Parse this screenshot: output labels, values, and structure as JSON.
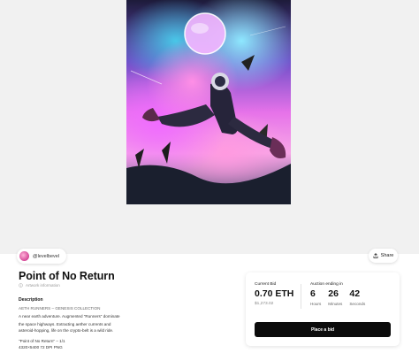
{
  "creator": {
    "handle": "@levelbevel"
  },
  "share": {
    "label": "Share"
  },
  "nft": {
    "title": "Point of No Return",
    "info_link": "Artwork information"
  },
  "description": {
    "label": "Description",
    "collection": "AETH RUNNERS – GENESIS COLLECTION",
    "line1": "A near earth adventure. Augmented \"Runners\" dominate",
    "line2": "the space highways. Extracting aether currents and",
    "line3": "asteroid-hopping, life on the crypto-belt is a wild ride.",
    "edition": "\"Point of No Return\" – 1/1",
    "dimensions": "4320×5400 72 DPI PNG"
  },
  "auction": {
    "current_bid_label": "Current Bid",
    "current_bid_value": "0.70 ETH",
    "current_bid_usd": "$1,273.02",
    "ending_label": "Auction ending in",
    "hours": "6",
    "hours_label": "Hours",
    "minutes": "26",
    "minutes_label": "Minutes",
    "seconds": "42",
    "seconds_label": "Seconds",
    "place_bid_label": "Place a bid"
  },
  "colors": {
    "button_bg": "#0b0b0b",
    "hero_bg": "#f1f1f1"
  },
  "icons": {
    "share": "share-icon",
    "info": "info-icon"
  }
}
